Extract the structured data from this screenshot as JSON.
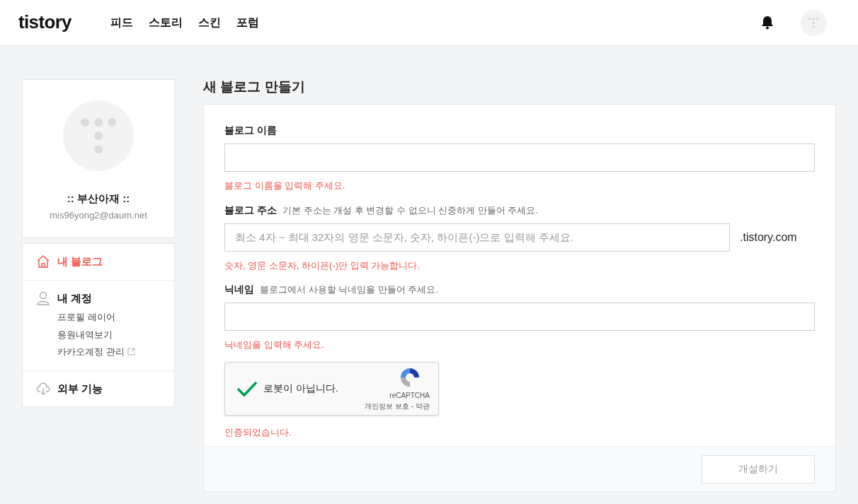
{
  "header": {
    "logo": "tistory",
    "nav": [
      {
        "label": "피드"
      },
      {
        "label": "스토리"
      },
      {
        "label": "스킨"
      },
      {
        "label": "포럼"
      }
    ]
  },
  "profile": {
    "name": ":: 부산아재 ::",
    "email": "mis96yong2@daum.net"
  },
  "menu": [
    {
      "label": "내 블로그",
      "selected": true
    },
    {
      "label": "내 계정",
      "selected": false,
      "children": [
        {
          "label": "프로필 레이어",
          "external": false
        },
        {
          "label": "응원내역보기",
          "external": false
        },
        {
          "label": "카카오계정 관리",
          "external": true
        }
      ]
    },
    {
      "label": "외부 기능",
      "selected": false
    }
  ],
  "page_title": "새 블로그 만들기",
  "fields": [
    {
      "label": "블로그 이름",
      "error": "블로그 이름을 입력해 주세요."
    },
    {
      "label": "블로그 주소",
      "hint": "기본 주소는 개설 후 변경할 수 없으니 신중하게 만들어 주세요.",
      "placeholder": "최소 4자 ~ 최대 32자의 영문 소문자, 숫자, 하이픈(-)으로 입력해 주세요.",
      "suffix": ".tistory.com",
      "error": "숫자, 영문 소문자, 하이픈(-)만 입력 가능합니다."
    },
    {
      "label": "닉네임",
      "hint": "블로그에서 사용할 닉네임을 만들어 주세요.",
      "error": "닉네임을 입력해 주세요."
    }
  ],
  "captcha": {
    "checked": true,
    "label": "로봇이 아닙니다.",
    "brand": "reCAPTCHA",
    "privacy": "개인정보 보호",
    "separator": "-",
    "terms": "약관",
    "message": "인증되었습니다."
  },
  "submit": {
    "label": "개설하기",
    "disabled": true
  }
}
